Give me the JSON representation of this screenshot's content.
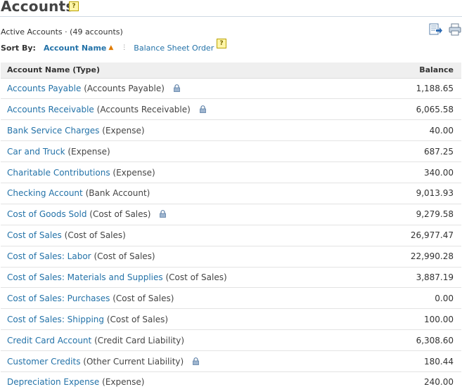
{
  "page": {
    "title": "Accounts",
    "help_glyph": "?",
    "subtitle": "Active Accounts · (49 accounts)",
    "sort_label": "Sort By:",
    "sort_active": "Account Name",
    "sort_separator": "⋮",
    "sort_alt": "Balance Sheet Order"
  },
  "toolbar": {
    "icons": [
      "export-icon",
      "print-icon"
    ]
  },
  "table": {
    "headers": {
      "name": "Account Name (Type)",
      "balance": "Balance"
    },
    "rows": [
      {
        "name": "Accounts Payable",
        "type": "(Accounts Payable)",
        "locked": true,
        "balance": "1,188.65"
      },
      {
        "name": "Accounts Receivable",
        "type": "(Accounts Receivable)",
        "locked": true,
        "balance": "6,065.58"
      },
      {
        "name": "Bank Service Charges",
        "type": "(Expense)",
        "locked": false,
        "balance": "40.00"
      },
      {
        "name": "Car and Truck",
        "type": "(Expense)",
        "locked": false,
        "balance": "687.25"
      },
      {
        "name": "Charitable Contributions",
        "type": "(Expense)",
        "locked": false,
        "balance": "340.00"
      },
      {
        "name": "Checking Account",
        "type": "(Bank Account)",
        "locked": false,
        "balance": "9,013.93"
      },
      {
        "name": "Cost of Goods Sold",
        "type": "(Cost of Sales)",
        "locked": true,
        "balance": "9,279.58"
      },
      {
        "name": "Cost of Sales",
        "type": "(Cost of Sales)",
        "locked": false,
        "balance": "26,977.47"
      },
      {
        "name": "Cost of Sales: Labor",
        "type": "(Cost of Sales)",
        "locked": false,
        "balance": "22,990.28"
      },
      {
        "name": "Cost of Sales: Materials and Supplies",
        "type": "(Cost of Sales)",
        "locked": false,
        "balance": "3,887.19"
      },
      {
        "name": "Cost of Sales: Purchases",
        "type": "(Cost of Sales)",
        "locked": false,
        "balance": "0.00"
      },
      {
        "name": "Cost of Sales: Shipping",
        "type": "(Cost of Sales)",
        "locked": false,
        "balance": "100.00"
      },
      {
        "name": "Credit Card Account",
        "type": "(Credit Card Liability)",
        "locked": false,
        "balance": "6,308.60"
      },
      {
        "name": "Customer Credits",
        "type": "(Other Current Liability)",
        "locked": true,
        "balance": "180.44"
      },
      {
        "name": "Depreciation Expense",
        "type": "(Expense)",
        "locked": false,
        "balance": "240.00"
      }
    ]
  }
}
